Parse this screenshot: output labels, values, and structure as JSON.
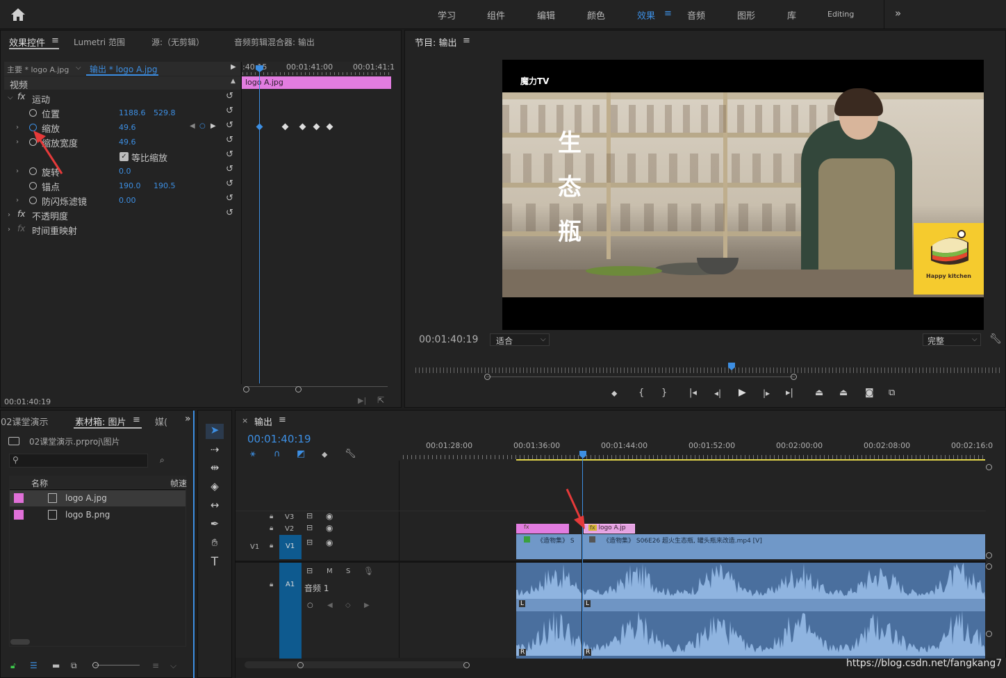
{
  "workspace_tabs": [
    {
      "label": "学习",
      "active": false
    },
    {
      "label": "组件",
      "active": false
    },
    {
      "label": "编辑",
      "active": false
    },
    {
      "label": "颜色",
      "active": false
    },
    {
      "label": "效果",
      "active": true
    },
    {
      "label": "音频",
      "active": false
    },
    {
      "label": "图形",
      "active": false
    },
    {
      "label": "库",
      "active": false
    },
    {
      "label": "Editing",
      "active": false
    }
  ],
  "effect_controls": {
    "tabs": [
      "效果控件",
      "Lumetri 范围",
      "源:（无剪辑）",
      "音频剪辑混合器: 输出"
    ],
    "master_clip": "主要 * logo A.jpg",
    "sequence_clip": "输出 * logo A.jpg",
    "section_video": "视频",
    "ruler": [
      "00:01:41:00",
      "00:01:41:1"
    ],
    "ruler_start": ":40:15",
    "clip_bar": "logo A.jpg",
    "rows": {
      "motion": "运动",
      "position": {
        "label": "位置",
        "x": "1188.6",
        "y": "529.8"
      },
      "scale": {
        "label": "缩放",
        "value": "49.6"
      },
      "scale_width": {
        "label": "缩放宽度",
        "value": "49.6"
      },
      "uniform": {
        "label": "等比缩放"
      },
      "rotation": {
        "label": "旋转",
        "value": "0.0"
      },
      "anchor": {
        "label": "锚点",
        "x": "190.0",
        "y": "190.5"
      },
      "antiflicker": {
        "label": "防闪烁滤镜",
        "value": "0.00"
      },
      "opacity": "不透明度",
      "time_remap": "时间重映射"
    },
    "timecode": "00:01:40:19"
  },
  "program": {
    "title": "节目: 输出",
    "watermark_text": "魔力TV",
    "caption_chars": [
      "生",
      "态",
      "瓶"
    ],
    "logo_text": "Happy kitchen",
    "timecode": "00:01:40:19",
    "fit": "适合",
    "quality": "完整"
  },
  "bin": {
    "tabs": [
      "02课堂演示",
      "素材箱: 图片",
      "媒("
    ],
    "path": "02课堂演示.prproj\\图片",
    "col_name": "名称",
    "col_rate": "帧速",
    "items": [
      {
        "name": "logo A.jpg",
        "color": "#e070d8"
      },
      {
        "name": "logo B.png",
        "color": "#e070d8"
      }
    ]
  },
  "timeline": {
    "tab": "输出",
    "timecode": "00:01:40:19",
    "ruler": [
      "00:01:28:00",
      "00:01:36:00",
      "00:01:44:00",
      "00:01:52:00",
      "00:02:00:00",
      "00:02:08:00",
      "00:02:16:0"
    ],
    "tracks": {
      "v3": "V3",
      "v2": "V2",
      "v1": "V1",
      "a1": "A1",
      "v1_src": "V1"
    },
    "audio_label": "音频 1",
    "clip_v2_b": "logo A.jp",
    "clip_v1_a": "《造物集》 S",
    "clip_v1_b": "《造物集》 S06E26 超火生态瓶, 罐头瓶来改造.mp4 [V]",
    "audio_M": "M",
    "audio_S": "S",
    "wave_L": "L",
    "wave_R": "R"
  },
  "footer_watermark": "https://blog.csdn.net/fangkang7"
}
